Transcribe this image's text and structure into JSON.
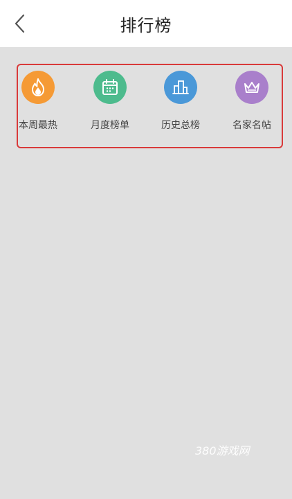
{
  "header": {
    "title": "排行榜",
    "back_icon": "chevron-left-icon"
  },
  "categories": [
    {
      "label": "本周最热",
      "icon": "flame-icon",
      "color": "#f59a35"
    },
    {
      "label": "月度榜单",
      "icon": "calendar-icon",
      "color": "#4dbb8d"
    },
    {
      "label": "历史总榜",
      "icon": "buildings-icon",
      "color": "#4a98d8"
    },
    {
      "label": "名家名帖",
      "icon": "crown-icon",
      "color": "#a97fcb"
    }
  ],
  "watermark": "380游戏网",
  "colors": {
    "background": "#e0e0e0",
    "header": "#ffffff",
    "highlight_border": "#d93a3a"
  }
}
